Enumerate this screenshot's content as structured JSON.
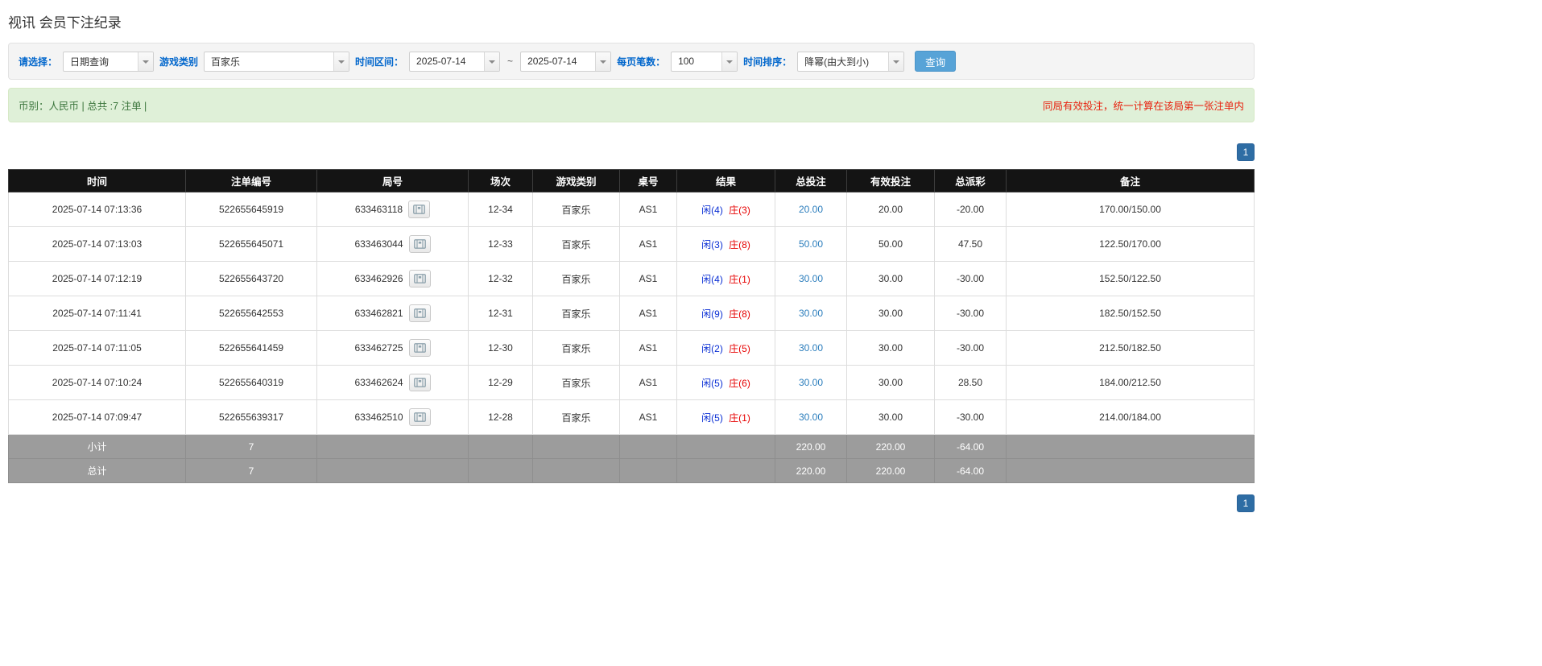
{
  "page": {
    "title": "视讯 会员下注纪录"
  },
  "colors": {
    "accent_blue": "#2e6da4",
    "search_button_blue": "#57a3d7",
    "link_blue": "#2b7dbc",
    "player_blue": "#0a2fd4",
    "banker_red": "#e60000",
    "negative_red": "#ff0000",
    "success_bar_bg": "#dff0d8",
    "notice_red": "#e8210e",
    "header_black": "#141414",
    "footer_gray": "#9c9c9c"
  },
  "filters": {
    "select_label": "请选择：",
    "select_value": "日期查询",
    "game_label": "游戏类别",
    "game_value": "百家乐",
    "range_label": "时间区间：",
    "date_from": "2025-07-14",
    "range_sep": "~",
    "date_to": "2025-07-14",
    "page_size_label": "每页笔数：",
    "page_size_value": "100",
    "sort_label": "时间排序：",
    "sort_value": "降幂(由大到小)",
    "search_button": "查询"
  },
  "info_bar": {
    "left": "币别：人民币 | 总共 :7 注单 |",
    "right": "同局有效投注，统一计算在该局第一张注单内"
  },
  "pagination": {
    "page": "1"
  },
  "table": {
    "headers": [
      "时间",
      "注单编号",
      "局号",
      "场次",
      "游戏类别",
      "桌号",
      "结果",
      "总投注",
      "有效投注",
      "总派彩",
      "备注"
    ],
    "rows": [
      {
        "time": "2025-07-14 07:13:36",
        "bet_id": "522655645919",
        "round_id": "633463118",
        "session": "12-34",
        "game": "百家乐",
        "table_no": "AS1",
        "result_player": "闲(4)",
        "result_banker": "庄(3)",
        "total_bet": "20.00",
        "valid_bet": "20.00",
        "payout": "-20.00",
        "note": "170.00/150.00"
      },
      {
        "time": "2025-07-14 07:13:03",
        "bet_id": "522655645071",
        "round_id": "633463044",
        "session": "12-33",
        "game": "百家乐",
        "table_no": "AS1",
        "result_player": "闲(3)",
        "result_banker": "庄(8)",
        "total_bet": "50.00",
        "valid_bet": "50.00",
        "payout": "47.50",
        "note": "122.50/170.00"
      },
      {
        "time": "2025-07-14 07:12:19",
        "bet_id": "522655643720",
        "round_id": "633462926",
        "session": "12-32",
        "game": "百家乐",
        "table_no": "AS1",
        "result_player": "闲(4)",
        "result_banker": "庄(1)",
        "total_bet": "30.00",
        "valid_bet": "30.00",
        "payout": "-30.00",
        "note": "152.50/122.50"
      },
      {
        "time": "2025-07-14 07:11:41",
        "bet_id": "522655642553",
        "round_id": "633462821",
        "session": "12-31",
        "game": "百家乐",
        "table_no": "AS1",
        "result_player": "闲(9)",
        "result_banker": "庄(8)",
        "total_bet": "30.00",
        "valid_bet": "30.00",
        "payout": "-30.00",
        "note": "182.50/152.50"
      },
      {
        "time": "2025-07-14 07:11:05",
        "bet_id": "522655641459",
        "round_id": "633462725",
        "session": "12-30",
        "game": "百家乐",
        "table_no": "AS1",
        "result_player": "闲(2)",
        "result_banker": "庄(5)",
        "total_bet": "30.00",
        "valid_bet": "30.00",
        "payout": "-30.00",
        "note": "212.50/182.50"
      },
      {
        "time": "2025-07-14 07:10:24",
        "bet_id": "522655640319",
        "round_id": "633462624",
        "session": "12-29",
        "game": "百家乐",
        "table_no": "AS1",
        "result_player": "闲(5)",
        "result_banker": "庄(6)",
        "total_bet": "30.00",
        "valid_bet": "30.00",
        "payout": "28.50",
        "note": "184.00/212.50"
      },
      {
        "time": "2025-07-14 07:09:47",
        "bet_id": "522655639317",
        "round_id": "633462510",
        "session": "12-28",
        "game": "百家乐",
        "table_no": "AS1",
        "result_player": "闲(5)",
        "result_banker": "庄(1)",
        "total_bet": "30.00",
        "valid_bet": "30.00",
        "payout": "-30.00",
        "note": "214.00/184.00"
      }
    ],
    "subtotal": {
      "label": "小计",
      "count": "7",
      "total_bet": "220.00",
      "valid_bet": "220.00",
      "payout": "-64.00"
    },
    "total": {
      "label": "总计",
      "count": "7",
      "total_bet": "220.00",
      "valid_bet": "220.00",
      "payout": "-64.00"
    }
  }
}
